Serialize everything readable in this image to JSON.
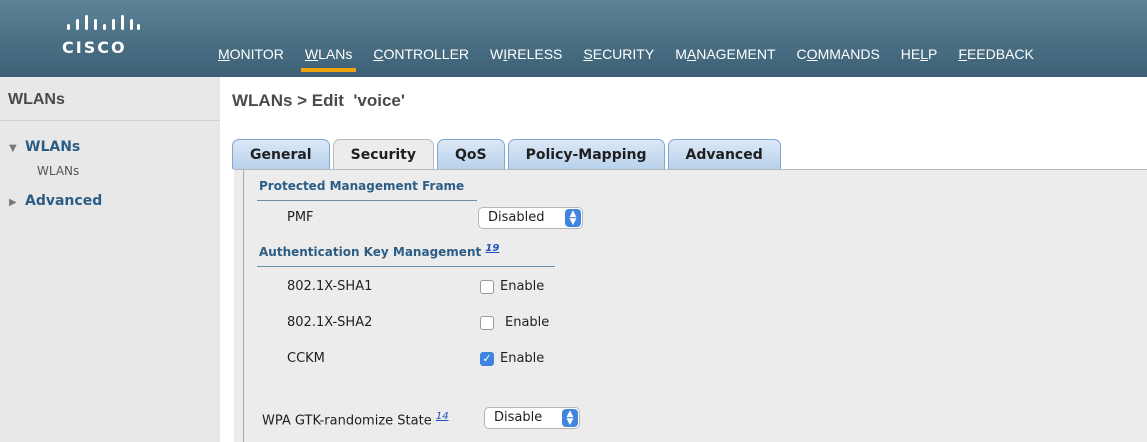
{
  "brand": {
    "logo_text": "CISCO"
  },
  "nav": [
    {
      "pre": "",
      "u": "M",
      "post": "ONITOR",
      "active": false
    },
    {
      "pre": "",
      "u": "W",
      "post": "LANs",
      "active": true
    },
    {
      "pre": "",
      "u": "C",
      "post": "ONTROLLER",
      "active": false
    },
    {
      "pre": "W",
      "u": "I",
      "post": "RELESS",
      "active": false
    },
    {
      "pre": "",
      "u": "S",
      "post": "ECURITY",
      "active": false
    },
    {
      "pre": "M",
      "u": "A",
      "post": "NAGEMENT",
      "active": false
    },
    {
      "pre": "C",
      "u": "O",
      "post": "MMANDS",
      "active": false
    },
    {
      "pre": "HE",
      "u": "L",
      "post": "P",
      "active": false
    },
    {
      "pre": "",
      "u": "F",
      "post": "EEDBACK",
      "active": false
    }
  ],
  "sidebar": {
    "title": "WLANs",
    "items": [
      {
        "label": "WLANs",
        "arrow": "▼",
        "children": [
          "WLANs"
        ]
      },
      {
        "label": "Advanced",
        "arrow": "▶",
        "children": []
      }
    ]
  },
  "page": {
    "title": "WLANs > Edit  'voice'"
  },
  "tabs": [
    {
      "label": "General",
      "active": false
    },
    {
      "label": "Security",
      "active": true
    },
    {
      "label": "QoS",
      "active": false
    },
    {
      "label": "Policy-Mapping",
      "active": false
    },
    {
      "label": "Advanced",
      "active": false
    }
  ],
  "pmf_section": {
    "title": "Protected Management Frame",
    "pmf_label": "PMF",
    "pmf_value": "Disabled"
  },
  "akm_section": {
    "title": "Authentication Key Management",
    "footnote": "19",
    "rows": [
      {
        "label": "802.1X-SHA1",
        "checked": false,
        "option": "Enable"
      },
      {
        "label": "802.1X-SHA2",
        "checked": false,
        "option": "Enable"
      },
      {
        "label": "CCKM",
        "checked": true,
        "option": "Enable"
      }
    ]
  },
  "gtk": {
    "label": "WPA GTK-randomize State",
    "footnote": "14",
    "value": "Disable"
  },
  "colors": {
    "accent": "#f0a20f",
    "link": "#2c5d85",
    "header": "#4a6f84",
    "check": "#3f85e0"
  }
}
